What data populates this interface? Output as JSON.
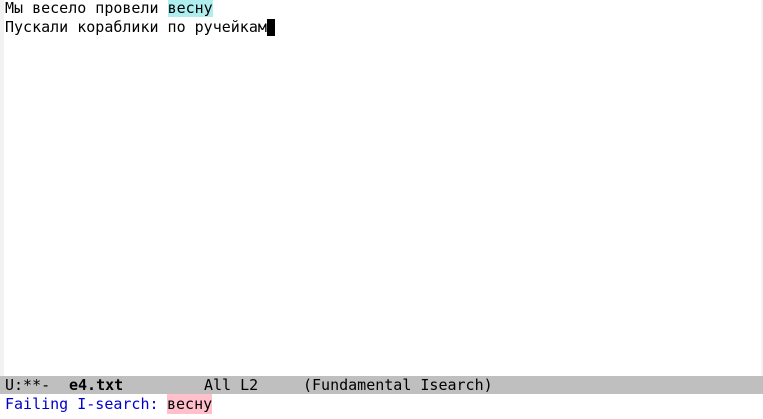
{
  "editor": {
    "lines": [
      {
        "before": "Мы весело провели ",
        "match": "весну"
      },
      {
        "text": "Пускали кораблики по ручейкам"
      }
    ]
  },
  "mode_line": {
    "status": "U:**-",
    "buffer_name": "e4.txt",
    "position": "All L2",
    "modes": "(Fundamental Isearch)"
  },
  "minibuffer": {
    "prompt": "Failing I-search: ",
    "input": "весну"
  },
  "colors": {
    "match_highlight": "#afeeee",
    "failed_input_highlight": "#ffc0cb",
    "mode_line_bg": "#bfbfbf",
    "prompt": "#0000cd"
  }
}
